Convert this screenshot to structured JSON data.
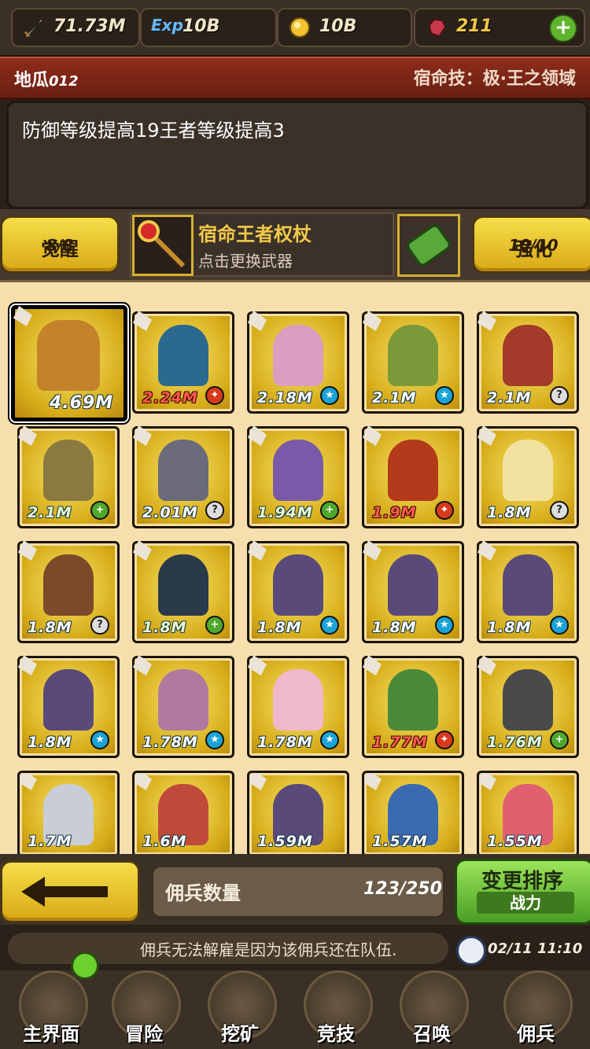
{
  "resources": {
    "attack": "71.73M",
    "exp_label": "Exp",
    "exp": "10B",
    "gold": "10B",
    "gems": "211",
    "plus_icon": "+"
  },
  "hero": {
    "name": "地瓜",
    "name_suffix": "012",
    "destiny_skill": "宿命技：极·王之领域",
    "description": "防御等级提高19王者等级提高3"
  },
  "awaken": {
    "label": "觉醒",
    "value": "8/8"
  },
  "weapon": {
    "name": "宿命王者权杖",
    "hint": "点击更换武器"
  },
  "enhance": {
    "label": "强化",
    "value": "10/10"
  },
  "cards": [
    {
      "power": "4.69M",
      "badge": "",
      "tone": "white",
      "color": "#c4822b"
    },
    {
      "power": "2.24M",
      "badge": "fire",
      "tone": "red",
      "color": "#2b6a8e"
    },
    {
      "power": "2.18M",
      "badge": "water",
      "tone": "white",
      "color": "#d99ec0"
    },
    {
      "power": "2.1M",
      "badge": "water",
      "tone": "white",
      "color": "#7a9a3a"
    },
    {
      "power": "2.1M",
      "badge": "q",
      "tone": "white",
      "color": "#a33a2a"
    },
    {
      "power": "2.1M",
      "badge": "plus",
      "tone": "grn",
      "color": "#8a7a40"
    },
    {
      "power": "2.01M",
      "badge": "q",
      "tone": "white",
      "color": "#6a6a7a"
    },
    {
      "power": "1.94M",
      "badge": "plus",
      "tone": "grn",
      "color": "#7a5aa8"
    },
    {
      "power": "1.9M",
      "badge": "fire",
      "tone": "red",
      "color": "#b33a1a"
    },
    {
      "power": "1.8M",
      "badge": "q",
      "tone": "white",
      "color": "#f2e2a0"
    },
    {
      "power": "1.8M",
      "badge": "q",
      "tone": "white",
      "color": "#7a4a2a"
    },
    {
      "power": "1.8M",
      "badge": "plus",
      "tone": "grn",
      "color": "#2a3a4a"
    },
    {
      "power": "1.8M",
      "badge": "water",
      "tone": "white",
      "color": "#5a4a7a"
    },
    {
      "power": "1.8M",
      "badge": "water",
      "tone": "white",
      "color": "#5a4a7a"
    },
    {
      "power": "1.8M",
      "badge": "water",
      "tone": "white",
      "color": "#5a4a7a"
    },
    {
      "power": "1.8M",
      "badge": "water",
      "tone": "white",
      "color": "#5a4a7a"
    },
    {
      "power": "1.78M",
      "badge": "water",
      "tone": "white",
      "color": "#b07aa0"
    },
    {
      "power": "1.78M",
      "badge": "water",
      "tone": "white",
      "color": "#f0b8cc"
    },
    {
      "power": "1.77M",
      "badge": "fire",
      "tone": "red",
      "color": "#4a8a3a"
    },
    {
      "power": "1.76M",
      "badge": "plus",
      "tone": "grn",
      "color": "#4a4a4a"
    },
    {
      "power": "1.7M",
      "badge": "",
      "tone": "white",
      "color": "#c8cdd8"
    },
    {
      "power": "1.6M",
      "badge": "",
      "tone": "white",
      "color": "#c04a3a"
    },
    {
      "power": "1.59M",
      "badge": "",
      "tone": "white",
      "color": "#5a4a7a"
    },
    {
      "power": "1.57M",
      "badge": "",
      "tone": "white",
      "color": "#3a6ab0"
    },
    {
      "power": "1.55M",
      "badge": "",
      "tone": "white",
      "color": "#e06070"
    }
  ],
  "footer": {
    "count_label": "佣兵数量",
    "count_value": "123/250",
    "sort_title": "变更排序",
    "sort_sub": "战力",
    "ticker": "佣兵无法解雇是因为该佣兵还在队伍.",
    "time": "02/11 11:10"
  },
  "nav": [
    {
      "label": "主界面",
      "icon": "map-scroll-icon"
    },
    {
      "label": "冒险",
      "icon": "island-icon"
    },
    {
      "label": "挖矿",
      "icon": "pickaxe-icon"
    },
    {
      "label": "竞技",
      "icon": "crossed-swords-icon"
    },
    {
      "label": "召唤",
      "icon": "summon-scroll-icon"
    },
    {
      "label": "佣兵",
      "icon": "tent-icon"
    }
  ],
  "colors": {
    "accent_gold": "#d9a815",
    "sort_green": "#4a9e25",
    "header_red": "#8e2c1b"
  }
}
